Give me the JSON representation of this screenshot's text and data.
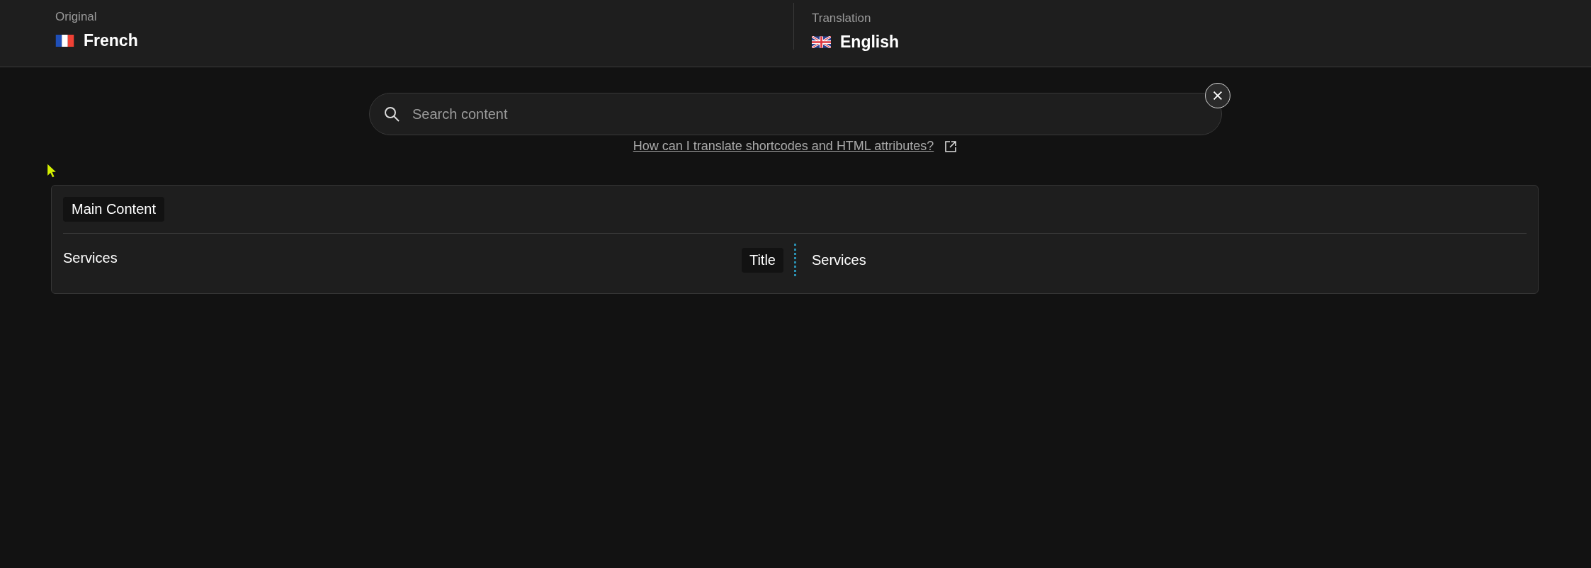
{
  "languages": [
    {
      "label": "Original",
      "name": "French",
      "kind": "fr"
    },
    {
      "label": "Translation",
      "name": "English",
      "kind": "uk"
    }
  ],
  "search": {
    "placeholder": "Search content"
  },
  "help_link": "How can I translate shortcodes and HTML attributes?",
  "section": {
    "title": "Main Content",
    "rows": [
      {
        "original": "Services",
        "field": "Title",
        "translation": "Services"
      }
    ]
  }
}
